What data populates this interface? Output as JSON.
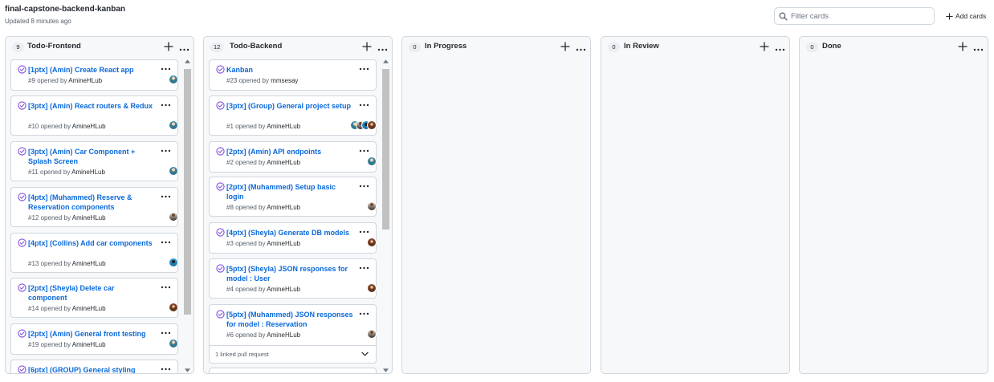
{
  "project": {
    "title": "final-capstone-backend-kanban",
    "updated": "Updated 8 minutes ago"
  },
  "filter": {
    "placeholder": "Filter cards",
    "value": ""
  },
  "add_cards": "Add cards",
  "opened_by": "opened by",
  "colors": {
    "accent": "#0969da",
    "open_issue": "#8250df",
    "border": "#d0d7de",
    "column_bg": "#f6f8fa"
  },
  "icons": {
    "status": "issue-open-icon",
    "more": "kebab-horizontal-icon",
    "add": "plus-icon",
    "search": "search-icon",
    "expand": "chevron-down-icon"
  },
  "columns": [
    {
      "name": "Todo-Frontend",
      "count": "9",
      "cards": [
        {
          "title": "[1ptx] (Amin) Create React app",
          "number": "#9",
          "author": "AmineHLub",
          "avatars": [
            "teal"
          ]
        },
        {
          "title": "[3ptx] (Amin) React routers & Redux",
          "number": "#10",
          "author": "AmineHLub",
          "avatars": [
            "teal"
          ]
        },
        {
          "title": "[3ptx] (Amin) Car Component + Splash Screen",
          "number": "#11",
          "author": "AmineHLub",
          "avatars": [
            "teal"
          ]
        },
        {
          "title": "[4ptx] (Muhammed) Reserve & Reservation components",
          "number": "#12",
          "author": "AmineHLub",
          "avatars": [
            "dark"
          ]
        },
        {
          "title": "[4ptx] (Collins) Add car components",
          "number": "#13",
          "author": "AmineHLub",
          "avatars": [
            "blue"
          ]
        },
        {
          "title": "[2ptx] (Sheyla) Delete car component",
          "number": "#14",
          "author": "AmineHLub",
          "avatars": [
            "brown"
          ]
        },
        {
          "title": "[2ptx] (Amin) General front testing",
          "number": "#19",
          "author": "AmineHLub",
          "avatars": [
            "teal"
          ]
        },
        {
          "title": "[6ptx] (GROUP) General styling",
          "number": "",
          "author": "",
          "avatars": []
        }
      ]
    },
    {
      "name": "Todo-Backend",
      "count": "12",
      "cards": [
        {
          "title": "Kanban",
          "number": "#23",
          "author": "mmsesay",
          "avatars": []
        },
        {
          "title": "[3ptx] (Group) General project setup",
          "number": "#1",
          "author": "AmineHLub",
          "avatars": [
            "teal",
            "dark",
            "blue",
            "brown"
          ]
        },
        {
          "title": "[2ptx] (Amin) API endpoints",
          "number": "#2",
          "author": "AmineHLub",
          "avatars": [
            "teal"
          ]
        },
        {
          "title": "[2ptx] (Muhammed) Setup basic login",
          "number": "#8",
          "author": "AmineHLub",
          "avatars": [
            "dark"
          ]
        },
        {
          "title": "[4ptx] (Sheyla) Generate DB models",
          "number": "#3",
          "author": "AmineHLub",
          "avatars": [
            "brown"
          ]
        },
        {
          "title": "[5ptx] (Sheyla) JSON responses for model : User",
          "number": "#4",
          "author": "AmineHLub",
          "avatars": [
            "brown"
          ]
        },
        {
          "title": "[5ptx] (Muhammed) JSON responses for model : Reservation",
          "number": "#6",
          "author": "AmineHLub",
          "avatars": [
            "dark"
          ],
          "linked": "1 linked pull request"
        },
        {
          "title": "",
          "number": "",
          "author": "",
          "avatars": []
        }
      ]
    },
    {
      "name": "In Progress",
      "count": "0",
      "cards": []
    },
    {
      "name": "In Review",
      "count": "0",
      "cards": []
    },
    {
      "name": "Done",
      "count": "0",
      "cards": []
    }
  ]
}
